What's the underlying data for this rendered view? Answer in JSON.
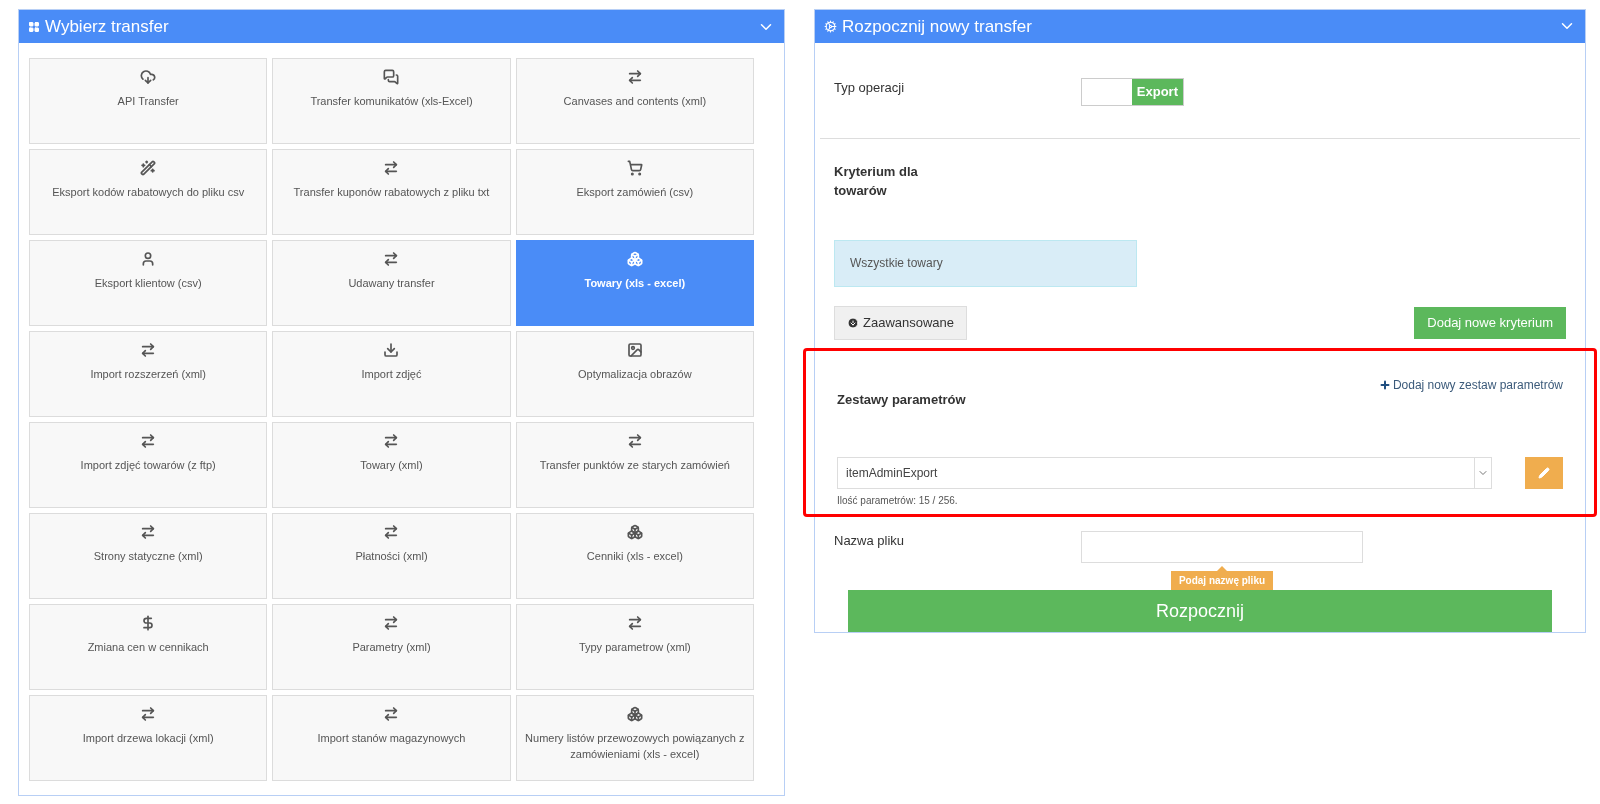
{
  "left_panel": {
    "title": "Wybierz transfer",
    "tiles": [
      {
        "kind": "cloud",
        "label": "API Transfer",
        "selected": false
      },
      {
        "kind": "comments",
        "label": "Transfer komunikatów (xls-Excel)",
        "selected": false
      },
      {
        "kind": "exchange",
        "label": "Canvases and contents (xml)",
        "selected": false
      },
      {
        "kind": "wand",
        "label": "Eksport kodów rabatowych do pliku csv",
        "selected": false
      },
      {
        "kind": "exchange",
        "label": "Transfer kuponów rabatowych z pliku txt",
        "selected": false
      },
      {
        "kind": "cart",
        "label": "Eksport zamówień (csv)",
        "selected": false
      },
      {
        "kind": "user",
        "label": "Eksport klientow (csv)",
        "selected": false
      },
      {
        "kind": "exchange",
        "label": "Udawany transfer",
        "selected": false
      },
      {
        "kind": "cubes",
        "label": "Towary (xls - excel)",
        "selected": true
      },
      {
        "kind": "exchange",
        "label": "Import rozszerzeń (xml)",
        "selected": false
      },
      {
        "kind": "download",
        "label": "Import zdjęć",
        "selected": false
      },
      {
        "kind": "image",
        "label": "Optymalizacja obrazów",
        "selected": false
      },
      {
        "kind": "exchange",
        "label": "Import zdjęć towarów (z ftp)",
        "selected": false
      },
      {
        "kind": "exchange",
        "label": "Towary (xml)",
        "selected": false
      },
      {
        "kind": "exchange",
        "label": "Transfer punktów ze starych zamówień",
        "selected": false
      },
      {
        "kind": "exchange",
        "label": "Strony statyczne (xml)",
        "selected": false
      },
      {
        "kind": "exchange",
        "label": "Płatności (xml)",
        "selected": false
      },
      {
        "kind": "cubes",
        "label": "Cenniki (xls - excel)",
        "selected": false
      },
      {
        "kind": "dollar",
        "label": "Zmiana cen w cennikach",
        "selected": false
      },
      {
        "kind": "exchange",
        "label": "Parametry (xml)",
        "selected": false
      },
      {
        "kind": "exchange",
        "label": "Typy parametrow (xml)",
        "selected": false
      },
      {
        "kind": "exchange",
        "label": "Import drzewa lokacji (xml)",
        "selected": false
      },
      {
        "kind": "exchange",
        "label": "Import stanów magazynowych",
        "selected": false
      },
      {
        "kind": "cubes",
        "label": "Numery listów przewozowych powiązanych z zamówieniami (xls - excel)",
        "selected": false
      }
    ]
  },
  "right_panel": {
    "title": "Rozpocznij nowy transfer",
    "operation": {
      "label": "Typ operacji",
      "value": "Export",
      "on": true
    },
    "criteria": {
      "title": "Kryterium dla towarów",
      "item": "Wszystkie towary",
      "advanced_button": "Zaawansowane",
      "add_button": "Dodaj nowe kryterium"
    },
    "parameter_sets": {
      "title": "Zestawy parametrów",
      "add_link": "Dodaj nowy zestaw parametrów",
      "select_value": "itemAdminExport",
      "count_text": "Ilość parametrów: 15 / 256.",
      "highlighted": true
    },
    "file_name": {
      "label": "Nazwa pliku",
      "hint": "Podaj nazwę pliku"
    },
    "start_button": "Rozpocznij"
  }
}
